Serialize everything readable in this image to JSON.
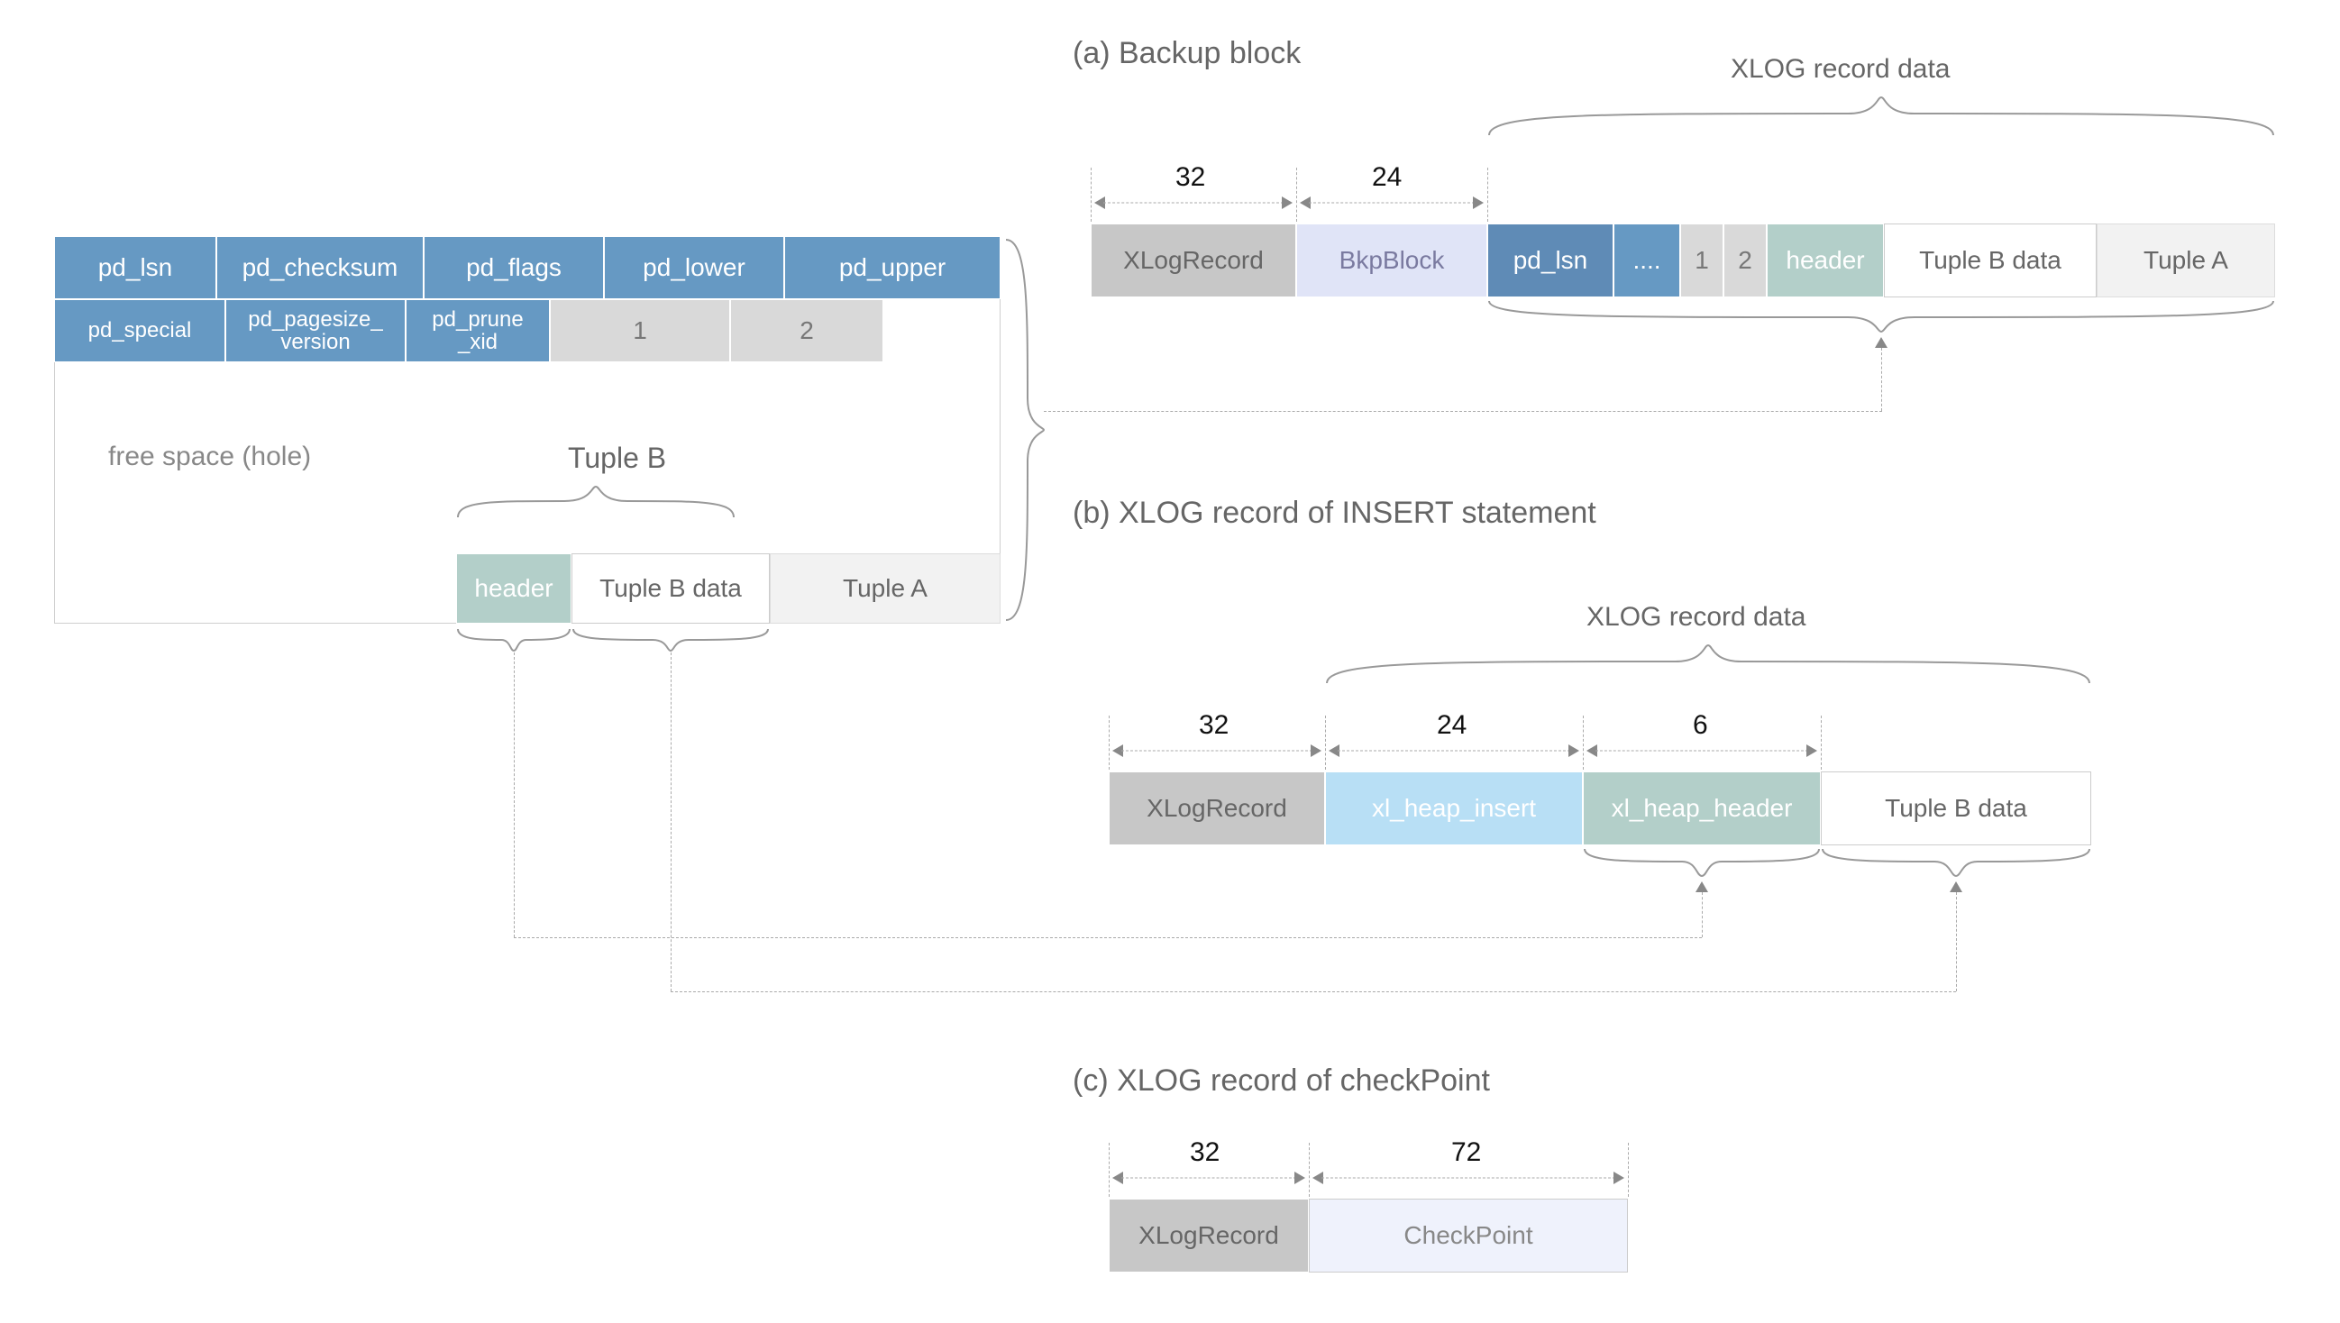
{
  "page": {
    "row1": {
      "pd_lsn": "pd_lsn",
      "pd_checksum": "pd_checksum",
      "pd_flags": "pd_flags",
      "pd_lower": "pd_lower",
      "pd_upper": "pd_upper"
    },
    "row2": {
      "pd_special": "pd_special",
      "pd_pagesize_version": "pd_pagesize_\nversion",
      "pd_prune_xid": "pd_prune\n_xid",
      "lp1": "1",
      "lp2": "2"
    },
    "free_space": "free space (hole)",
    "tuple_b_label": "Tuple B",
    "tuples": {
      "header": "header",
      "tuple_b_data": "Tuple B data",
      "tuple_a": "Tuple A"
    }
  },
  "diagrams": {
    "a": {
      "title": "(a) Backup block",
      "data_label": "XLOG record data",
      "dims": {
        "xlogrecord": "32",
        "bkp": "24"
      },
      "cells": {
        "xlogrecord": "XLogRecord",
        "bkp": "BkpBlock",
        "pd_lsn": "pd_lsn",
        "dots": "....",
        "lp1": "1",
        "lp2": "2",
        "header": "header",
        "tuple_b_data": "Tuple B data",
        "tuple_a": "Tuple A"
      }
    },
    "b": {
      "title": "(b) XLOG record of INSERT statement",
      "data_label": "XLOG record data",
      "dims": {
        "xlogrecord": "32",
        "insert": "24",
        "header": "6"
      },
      "cells": {
        "xlogrecord": "XLogRecord",
        "insert": "xl_heap_insert",
        "header": "xl_heap_header",
        "tuple_b_data": "Tuple B data"
      }
    },
    "c": {
      "title": "(c) XLOG record of checkPoint",
      "dims": {
        "xlogrecord": "32",
        "checkpoint": "72"
      },
      "cells": {
        "xlogrecord": "XLogRecord",
        "checkpoint": "CheckPoint"
      }
    }
  }
}
